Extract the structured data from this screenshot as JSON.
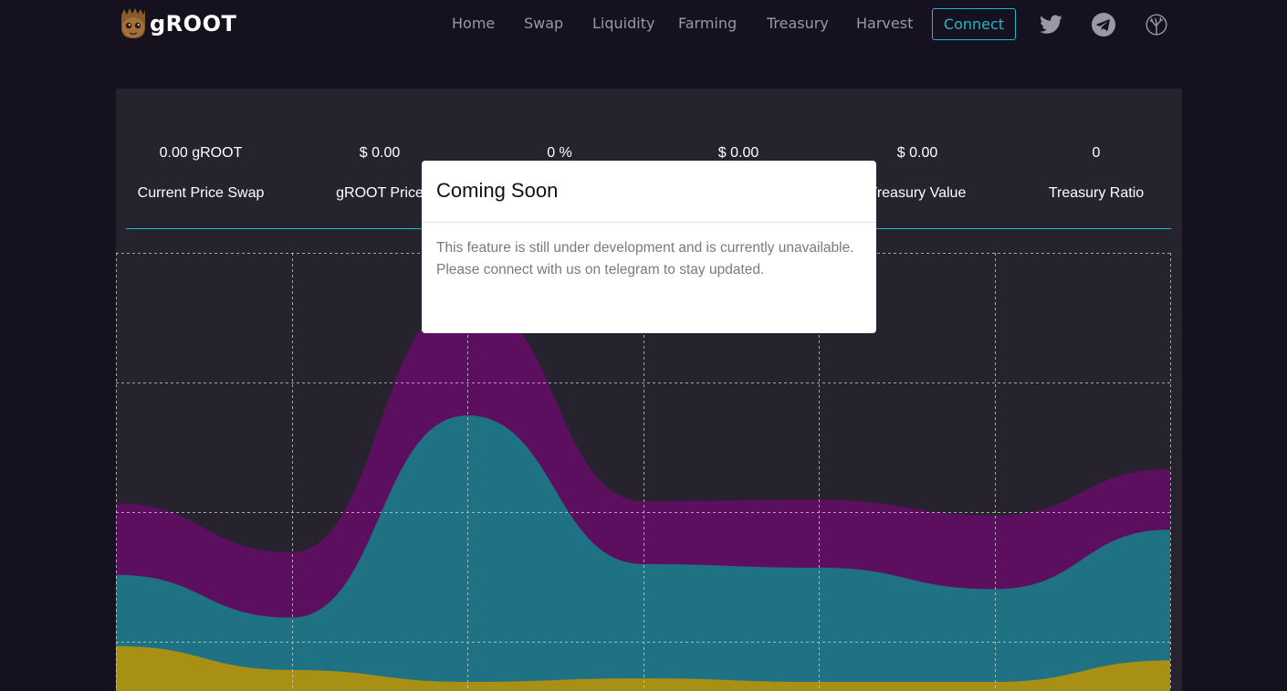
{
  "brand": {
    "name": "gROOT"
  },
  "nav": {
    "items": [
      {
        "label": "Home"
      },
      {
        "label": "Swap"
      },
      {
        "label": "Liquidity"
      },
      {
        "label": "Farming"
      },
      {
        "label": "Treasury"
      },
      {
        "label": "Harvest"
      }
    ],
    "connect_label": "Connect",
    "social_icons": [
      "twitter-icon",
      "telegram-icon",
      "tree-icon"
    ]
  },
  "stats": [
    {
      "value": "0.00 gROOT",
      "label": "Current Price Swap"
    },
    {
      "value": "$ 0.00",
      "label": "gROOT Price"
    },
    {
      "value": "0 %",
      "label": ""
    },
    {
      "value": "$ 0.00",
      "label": ""
    },
    {
      "value": "$ 0.00",
      "label": "Treasury Value"
    },
    {
      "value": "0",
      "label": "Treasury Ratio"
    }
  ],
  "chart_data": {
    "type": "area",
    "stacked": true,
    "grid": true,
    "categories": [
      "",
      "",
      "",
      "",
      "",
      "",
      ""
    ],
    "series": [
      {
        "color": "#a89014",
        "values": [
          30,
          10,
          0,
          3,
          0,
          0,
          18
        ]
      },
      {
        "color": "#1f7283",
        "values": [
          60,
          44,
          224,
          96,
          96,
          78,
          110
        ]
      },
      {
        "color": "#5c0f5e",
        "values": [
          60,
          55,
          99,
          53,
          57,
          62,
          51
        ]
      }
    ],
    "ylim": [
      0,
      330
    ]
  },
  "modal": {
    "title": "Coming Soon",
    "body": "This feature is still under development and is currently unavailable. Please connect with us on telegram to stay updated."
  },
  "colors": {
    "background": "#15111f",
    "panel": "#26232e",
    "accent": "#22b8c9"
  }
}
